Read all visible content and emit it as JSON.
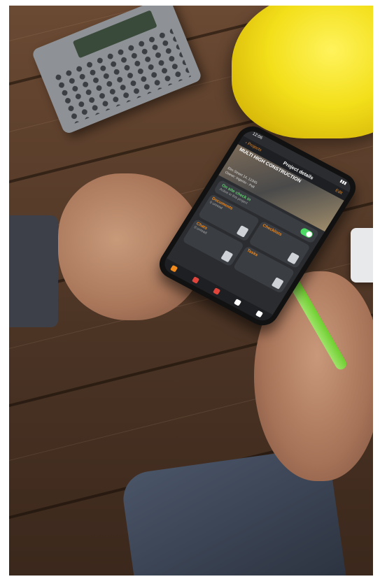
{
  "phone_app": {
    "status_time": "12:06",
    "nav": {
      "back_label": "Projects",
      "title": "Project details",
      "edit_label": "Edit"
    },
    "project": {
      "name": "MULTI HIGH CONSTRUCTION",
      "info_line_1": "Elm Street 14, 12345",
      "info_line_2": "Owner: Ingenio - Pell"
    },
    "check_in": {
      "label": "On site check in",
      "sub": "Active in this project",
      "state": "on"
    },
    "tiles": [
      {
        "title": "Documents",
        "subtitle": "0 unread",
        "icon": "document-icon"
      },
      {
        "title": "Checklists",
        "subtitle": "",
        "icon": "checklist-icon"
      },
      {
        "title": "Chats",
        "subtitle": "0 unread",
        "icon": "chat-icon"
      },
      {
        "title": "Tasks",
        "subtitle": "",
        "icon": "clipboard-icon"
      }
    ],
    "tabbar": [
      {
        "icon": "home-icon",
        "color": "#f08a1c"
      },
      {
        "icon": "alert-icon",
        "color": "#e0443a"
      },
      {
        "icon": "person-icon",
        "color": "#e0443a"
      },
      {
        "icon": "star-icon",
        "color": "#ffffff"
      },
      {
        "icon": "profile-icon",
        "color": "#ffffff"
      }
    ]
  },
  "colors": {
    "accent": "#f08a1c",
    "toggle_on": "#4cd964",
    "app_bg": "#2a2c30"
  }
}
